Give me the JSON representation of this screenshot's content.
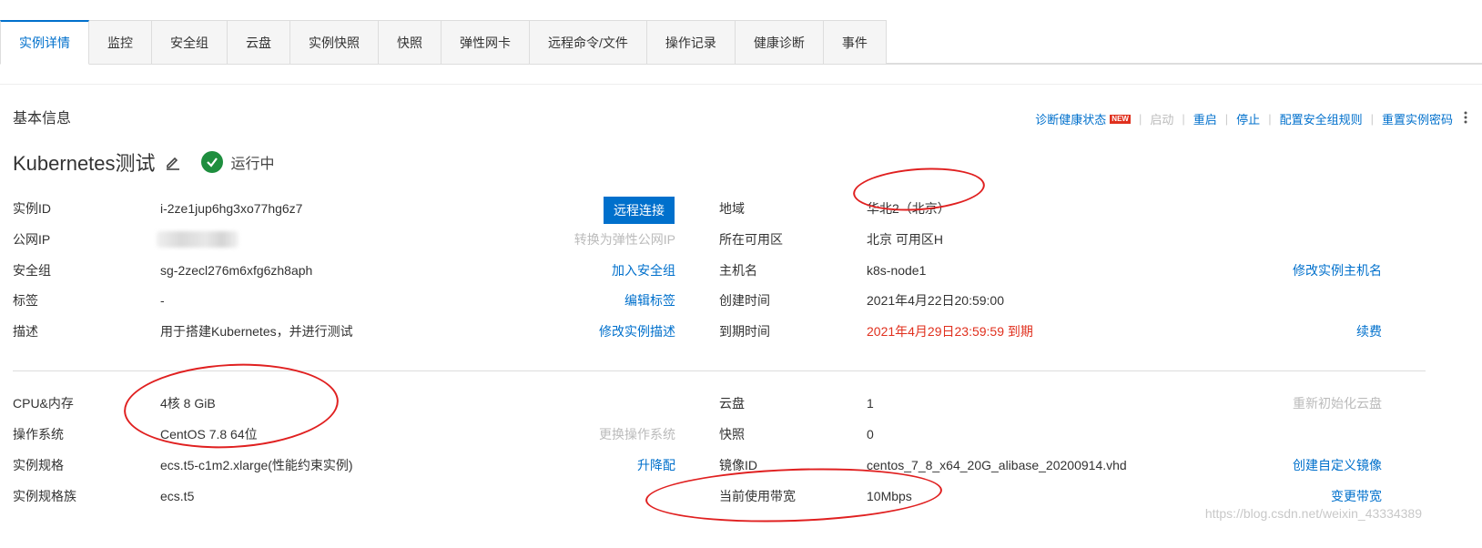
{
  "tabs": [
    {
      "label": "实例详情",
      "active": true
    },
    {
      "label": "监控"
    },
    {
      "label": "安全组"
    },
    {
      "label": "云盘"
    },
    {
      "label": "实例快照"
    },
    {
      "label": "快照"
    },
    {
      "label": "弹性网卡"
    },
    {
      "label": "远程命令/文件"
    },
    {
      "label": "操作记录"
    },
    {
      "label": "健康诊断"
    },
    {
      "label": "事件"
    }
  ],
  "section_title": "基本信息",
  "actions": {
    "diagnose": "诊断健康状态",
    "new_badge": "NEW",
    "start": "启动",
    "restart": "重启",
    "stop": "停止",
    "config_sg_rules": "配置安全组规则",
    "reset_password": "重置实例密码"
  },
  "instance": {
    "name": "Kubernetes测试",
    "status": "运行中"
  },
  "left_rows": {
    "instance_id": {
      "label": "实例ID",
      "value": "i-2ze1jup6hg3xo77hg6z7",
      "action": "远程连接"
    },
    "public_ip": {
      "label": "公网IP",
      "value": "",
      "action": "转换为弹性公网IP"
    },
    "security_group": {
      "label": "安全组",
      "value": "sg-2zecl276m6xfg6zh8aph",
      "action": "加入安全组"
    },
    "tags": {
      "label": "标签",
      "value": "-",
      "action": "编辑标签"
    },
    "description": {
      "label": "描述",
      "value": "用于搭建Kubernetes，并进行测试",
      "action": "修改实例描述"
    }
  },
  "right_rows": {
    "region": {
      "label": "地域",
      "value": "华北2（北京）"
    },
    "zone": {
      "label": "所在可用区",
      "value": "北京 可用区H"
    },
    "hostname": {
      "label": "主机名",
      "value": "k8s-node1",
      "action": "修改实例主机名"
    },
    "created": {
      "label": "创建时间",
      "value": "2021年4月22日20:59:00"
    },
    "expires": {
      "label": "到期时间",
      "value": "2021年4月29日23:59:59 到期",
      "action": "续费"
    }
  },
  "config_left": {
    "cpu_mem": {
      "label": "CPU&内存",
      "value": "4核 8 GiB"
    },
    "os": {
      "label": "操作系统",
      "value": "CentOS 7.8 64位",
      "action": "更换操作系统"
    },
    "spec": {
      "label": "实例规格",
      "value": "ecs.t5-c1m2.xlarge(性能约束实例)",
      "action": "升降配"
    },
    "family": {
      "label": "实例规格族",
      "value": "ecs.t5"
    }
  },
  "config_right": {
    "disk": {
      "label": "云盘",
      "value": "1",
      "action": "重新初始化云盘"
    },
    "snapshot": {
      "label": "快照",
      "value": "0"
    },
    "image": {
      "label": "镜像ID",
      "value": "centos_7_8_x64_20G_alibase_20200914.vhd",
      "action": "创建自定义镜像"
    },
    "bandwidth": {
      "label": "当前使用带宽",
      "value": "10Mbps",
      "action": "变更带宽"
    }
  },
  "watermark": "https://blog.csdn.net/weixin_43334389",
  "colors": {
    "accent": "#0070cc",
    "warning": "#e0301e",
    "status_ok": "#1e8e3e",
    "annotation": "#e02020"
  }
}
